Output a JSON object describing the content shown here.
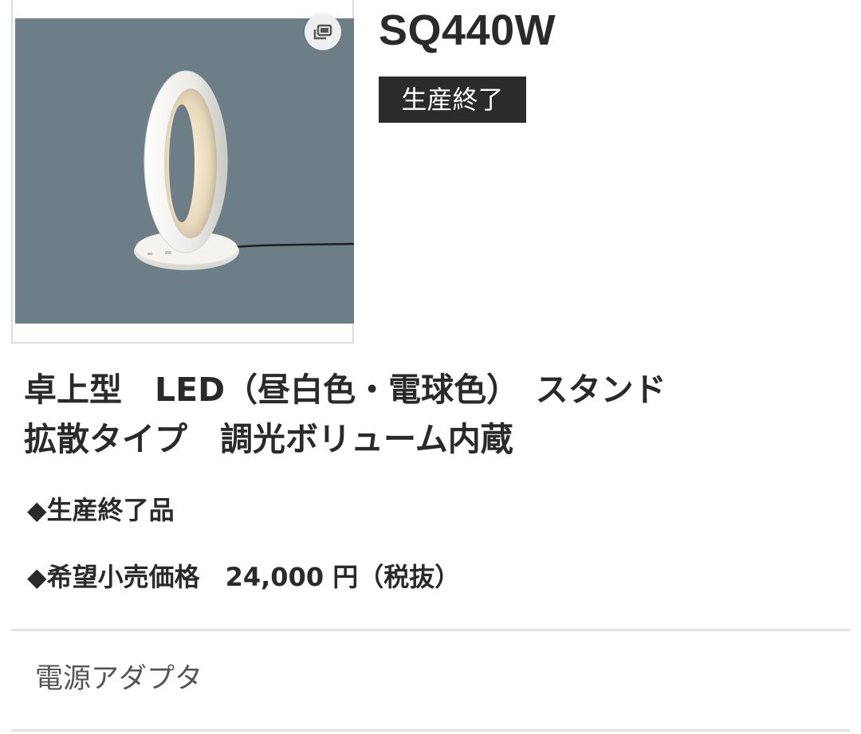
{
  "product": {
    "model_number": "SQ440W",
    "status_badge": "生産終了",
    "title_line1": "卓上型　LED（昼白色・電球色）　スタンド",
    "title_line2": "拡散タイプ　調光ボリューム内蔵",
    "discontinued_note": "◆生産終了品",
    "price_line": "◆希望小売価格　24,000 円（税抜）"
  },
  "image": {
    "background_color": "#6e7e86",
    "expand_icon": "expand-image-icon"
  },
  "accessory": {
    "label": "電源アダプタ"
  },
  "colors": {
    "badge_background": "#2b2b2b",
    "text": "#2a2a2a",
    "divider": "#e2e2e2"
  }
}
